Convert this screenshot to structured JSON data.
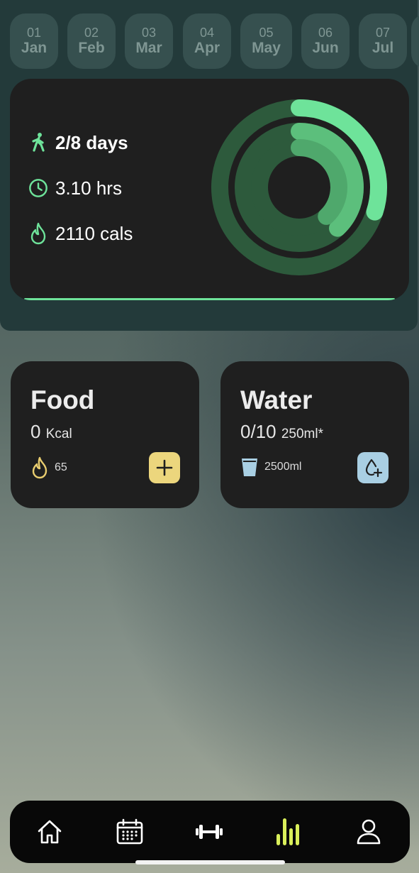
{
  "months": [
    {
      "num": "01",
      "name": "Jan"
    },
    {
      "num": "02",
      "name": "Feb"
    },
    {
      "num": "03",
      "name": "Mar"
    },
    {
      "num": "04",
      "name": "Apr"
    },
    {
      "num": "05",
      "name": "May"
    },
    {
      "num": "06",
      "name": "Jun"
    },
    {
      "num": "07",
      "name": "Jul"
    }
  ],
  "activity": {
    "days_text": "2/8 days",
    "hours_text": "3.10 hrs",
    "cals_text": "2110 cals",
    "ring_progress": {
      "outer": 0.3,
      "middle": 0.38,
      "inner": 0.38
    }
  },
  "food": {
    "title": "Food",
    "value": "0",
    "unit": "Kcal",
    "flame_count": "65"
  },
  "water": {
    "title": "Water",
    "value": "0/10",
    "unit": "250ml*",
    "total": "2500ml"
  },
  "nav": {
    "items": [
      "home-icon",
      "calendar-icon",
      "dumbbell-icon",
      "bar-chart-icon",
      "profile-icon"
    ],
    "active": "bar-chart-icon"
  },
  "colors": {
    "accent_green": "#6ee39a",
    "ring_mid": "#5cbf7c",
    "ring_track": "#2d5a3c",
    "food_button": "#ecd67d",
    "food_icon": "#e9cd6f",
    "water_button": "#a9cfe3",
    "water_icon": "#a9cfe3",
    "nav_active": "#d9ef5a"
  }
}
